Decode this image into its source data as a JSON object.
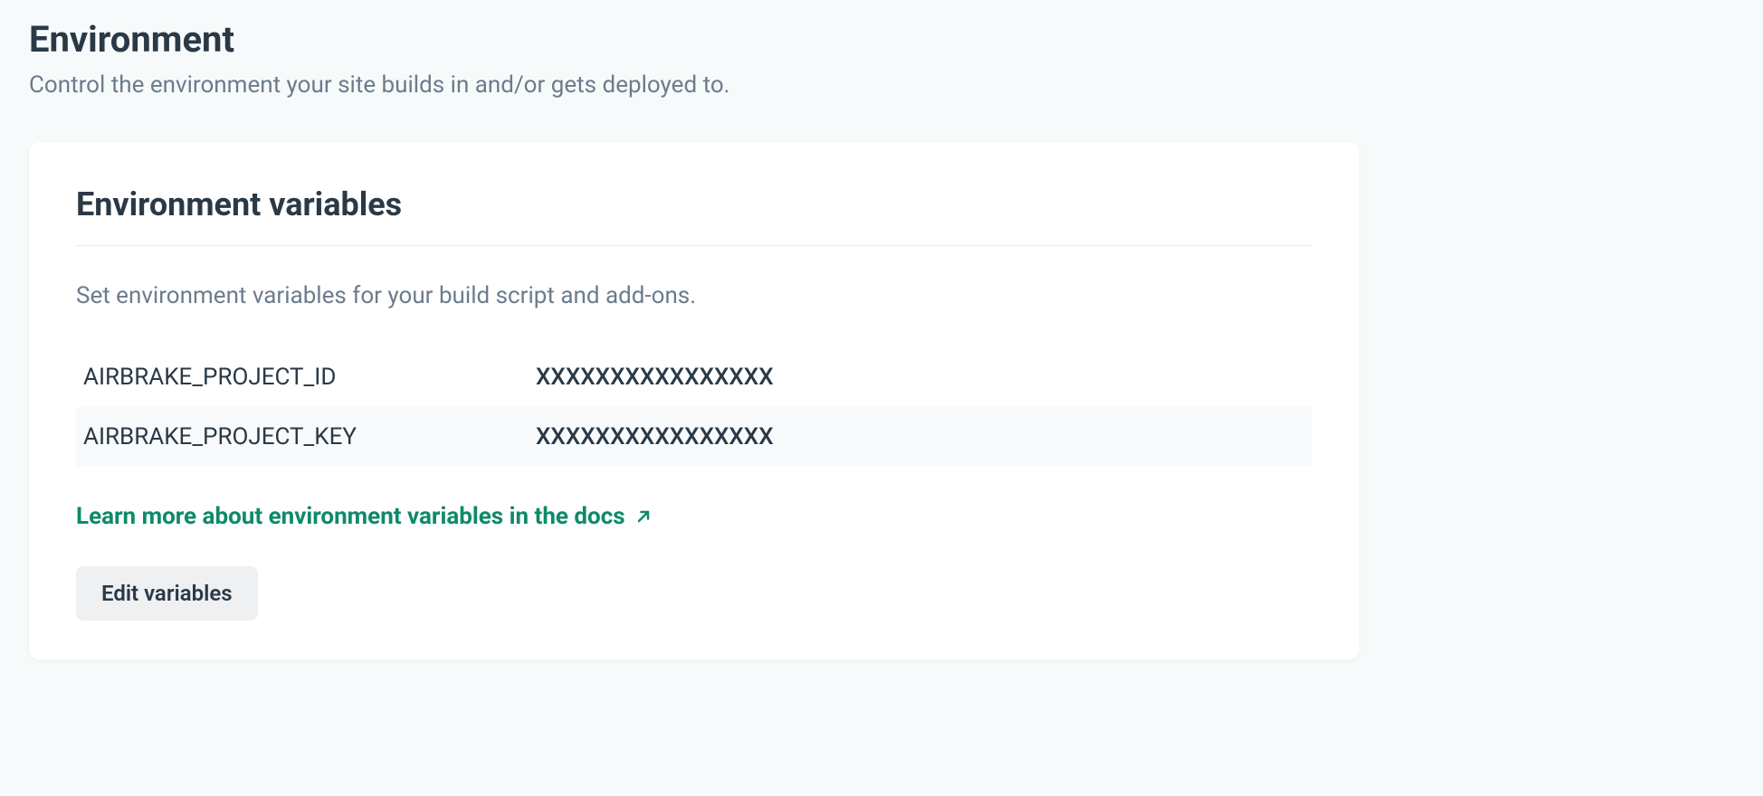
{
  "header": {
    "title": "Environment",
    "subtitle": "Control the environment your site builds in and/or gets deployed to."
  },
  "card": {
    "title": "Environment variables",
    "description": "Set environment variables for your build script and add-ons.",
    "variables": [
      {
        "name": "AIRBRAKE_PROJECT_ID",
        "value": "XXXXXXXXXXXXXXXX"
      },
      {
        "name": "AIRBRAKE_PROJECT_KEY",
        "value": "XXXXXXXXXXXXXXXX"
      }
    ],
    "docs_link_label": "Learn more about environment variables in the docs",
    "edit_button_label": "Edit variables"
  }
}
